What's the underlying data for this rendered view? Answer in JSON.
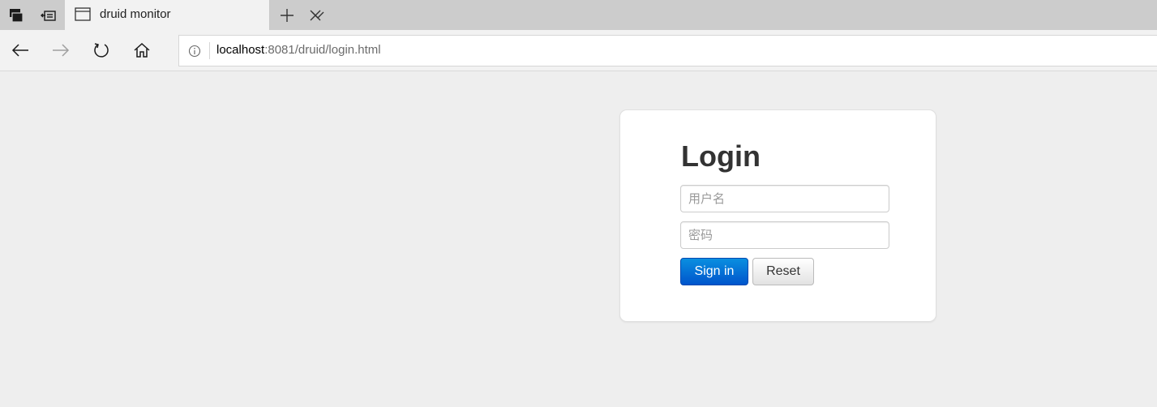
{
  "browser": {
    "tab": {
      "title": "druid monitor"
    },
    "address_bar": {
      "host": "localhost",
      "rest": ":8081/druid/login.html"
    },
    "icons": {
      "tab_manager": "tab-manager-icon",
      "set_aside": "set-aside-tabs-icon",
      "page": "page-icon",
      "close": "close-icon",
      "new_tab": "plus-icon",
      "tab_list": "chevron-down-icon",
      "back": "back-arrow-icon",
      "forward": "forward-arrow-icon",
      "refresh": "refresh-icon",
      "home": "home-icon",
      "site_info": "info-icon"
    }
  },
  "login": {
    "title": "Login",
    "username_placeholder": "用户名",
    "password_placeholder": "密码",
    "signin_label": "Sign in",
    "reset_label": "Reset"
  },
  "colors": {
    "primary_button": "#0055cc",
    "page_background": "#eeeeee"
  }
}
